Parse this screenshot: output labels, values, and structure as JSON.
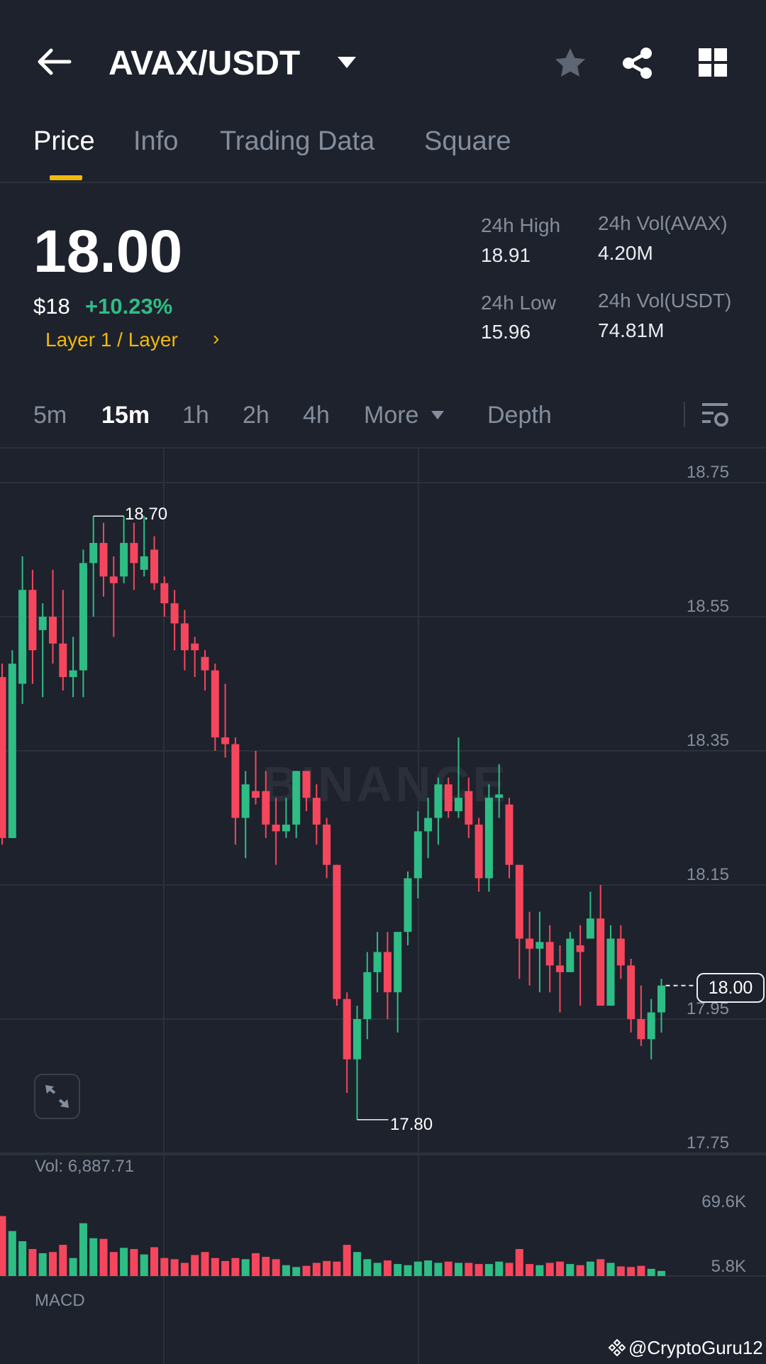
{
  "header": {
    "title": "AVAX/USDT",
    "back_icon": "arrow-left-icon",
    "dropdown_icon": "caret-down-icon",
    "favorite_icon": "star-icon",
    "share_icon": "share-icon",
    "grid_icon": "grid-icon"
  },
  "tabs": [
    {
      "label": "Price",
      "active": true
    },
    {
      "label": "Info"
    },
    {
      "label": "Trading Data"
    },
    {
      "label": "Square"
    }
  ],
  "ticker": {
    "last_price": "18.00",
    "usd_price": "$18",
    "change": "+10.23%",
    "category": "Layer 1 / Layer",
    "category_chevron": "›",
    "high_label": "24h High",
    "high": "18.91",
    "low_label": "24h Low",
    "low": "15.96",
    "vol_base_label": "24h Vol(AVAX)",
    "vol_base": "4.20M",
    "vol_quote_label": "24h Vol(USDT)",
    "vol_quote": "74.81M"
  },
  "intervals": [
    {
      "label": "5m"
    },
    {
      "label": "15m",
      "active": true
    },
    {
      "label": "1h"
    },
    {
      "label": "2h"
    },
    {
      "label": "4h"
    },
    {
      "label": "More"
    }
  ],
  "depth_label": "Depth",
  "chart_labels": {
    "watermark": "BINANCE",
    "high_marker": "18.70",
    "low_marker": "17.80",
    "last_price": "18.00",
    "volume": "Vol: 6,887.71",
    "macd": "MACD",
    "footer": "@CryptoGuru12"
  },
  "colors": {
    "up": "#2ebd85",
    "down": "#f6465d",
    "accent": "#f0b90b",
    "background": "#1e222d"
  },
  "chart_data": {
    "type": "candlestick",
    "interval": "15m",
    "price_ticks": [
      "18.75",
      "18.55",
      "18.35",
      "18.15",
      "17.95",
      "17.75"
    ],
    "price_tick_values": [
      18.75,
      18.55,
      18.35,
      18.15,
      17.95,
      17.75
    ],
    "volume_ticks": [
      "69.6K",
      "5.8K"
    ],
    "ohlc": [
      [
        18.46,
        18.48,
        18.21,
        18.22
      ],
      [
        18.22,
        18.5,
        18.22,
        18.48
      ],
      [
        18.45,
        18.64,
        18.42,
        18.59
      ],
      [
        18.59,
        18.62,
        18.45,
        18.5
      ],
      [
        18.53,
        18.57,
        18.43,
        18.55
      ],
      [
        18.55,
        18.62,
        18.48,
        18.51
      ],
      [
        18.51,
        18.59,
        18.44,
        18.46
      ],
      [
        18.46,
        18.52,
        18.43,
        18.47
      ],
      [
        18.47,
        18.65,
        18.43,
        18.63
      ],
      [
        18.63,
        18.7,
        18.55,
        18.66
      ],
      [
        18.66,
        18.69,
        18.58,
        18.61
      ],
      [
        18.61,
        18.64,
        18.52,
        18.6
      ],
      [
        18.61,
        18.7,
        18.6,
        18.66
      ],
      [
        18.66,
        18.69,
        18.59,
        18.63
      ],
      [
        18.62,
        18.7,
        18.61,
        18.64
      ],
      [
        18.65,
        18.67,
        18.59,
        18.6
      ],
      [
        18.6,
        18.61,
        18.55,
        18.57
      ],
      [
        18.57,
        18.59,
        18.5,
        18.54
      ],
      [
        18.54,
        18.56,
        18.47,
        18.5
      ],
      [
        18.51,
        18.52,
        18.46,
        18.5
      ],
      [
        18.49,
        18.5,
        18.44,
        18.47
      ],
      [
        18.47,
        18.48,
        18.35,
        18.37
      ],
      [
        18.37,
        18.45,
        18.34,
        18.36
      ],
      [
        18.36,
        18.37,
        18.21,
        18.25
      ],
      [
        18.25,
        18.32,
        18.19,
        18.3
      ],
      [
        18.29,
        18.35,
        18.27,
        18.28
      ],
      [
        18.29,
        18.32,
        18.22,
        18.24
      ],
      [
        18.24,
        18.28,
        18.18,
        18.23
      ],
      [
        18.23,
        18.28,
        18.22,
        18.24
      ],
      [
        18.24,
        18.32,
        18.22,
        18.32
      ],
      [
        18.32,
        18.32,
        18.26,
        18.28
      ],
      [
        18.28,
        18.3,
        18.21,
        18.24
      ],
      [
        18.24,
        18.25,
        18.16,
        18.18
      ],
      [
        18.18,
        18.18,
        17.97,
        17.98
      ],
      [
        17.98,
        17.99,
        17.84,
        17.89
      ],
      [
        17.89,
        17.97,
        17.8,
        17.95
      ],
      [
        17.95,
        18.05,
        17.92,
        18.02
      ],
      [
        18.02,
        18.08,
        17.99,
        18.05
      ],
      [
        18.05,
        18.08,
        17.95,
        17.99
      ],
      [
        17.99,
        18.08,
        17.93,
        18.08
      ],
      [
        18.08,
        18.17,
        18.06,
        18.16
      ],
      [
        18.16,
        18.26,
        18.13,
        18.23
      ],
      [
        18.23,
        18.28,
        18.19,
        18.25
      ],
      [
        18.25,
        18.31,
        18.21,
        18.3
      ],
      [
        18.3,
        18.31,
        18.25,
        18.26
      ],
      [
        18.26,
        18.37,
        18.25,
        18.28
      ],
      [
        18.29,
        18.31,
        18.22,
        18.24
      ],
      [
        18.24,
        18.25,
        18.14,
        18.16
      ],
      [
        18.16,
        18.3,
        18.14,
        18.28
      ],
      [
        18.28,
        18.33,
        18.25,
        18.285
      ],
      [
        18.27,
        18.28,
        18.16,
        18.18
      ],
      [
        18.18,
        18.18,
        18.01,
        18.07
      ],
      [
        18.07,
        18.11,
        18.0,
        18.055
      ],
      [
        18.055,
        18.11,
        17.99,
        18.065
      ],
      [
        18.065,
        18.09,
        17.99,
        18.03
      ],
      [
        18.03,
        18.06,
        17.96,
        18.02
      ],
      [
        18.02,
        18.08,
        18.02,
        18.07
      ],
      [
        18.06,
        18.09,
        17.97,
        18.05
      ],
      [
        18.07,
        18.14,
        18.07,
        18.1
      ],
      [
        18.1,
        18.15,
        17.97,
        17.97
      ],
      [
        17.97,
        18.09,
        17.97,
        18.07
      ],
      [
        18.07,
        18.09,
        18.01,
        18.03
      ],
      [
        18.03,
        18.04,
        17.93,
        17.95
      ],
      [
        17.95,
        18.0,
        17.91,
        17.92
      ],
      [
        17.92,
        17.98,
        17.89,
        17.96
      ],
      [
        17.96,
        18.01,
        17.93,
        18.0
      ]
    ],
    "volume_k": [
      82.0,
      61.5,
      47.6,
      36.9,
      31.2,
      32.8,
      42.6,
      24.6,
      72.2,
      51.7,
      50.8,
      32.8,
      38.5,
      36.9,
      29.5,
      39.4,
      24.6,
      23.0,
      18.0,
      28.7,
      32.8,
      24.6,
      20.5,
      24.6,
      23.0,
      31.2,
      26.2,
      23.0,
      14.8,
      12.3,
      13.9,
      18.0,
      20.5,
      19.7,
      42.6,
      32.8,
      23.0,
      18.0,
      21.3,
      16.4,
      14.8,
      19.7,
      21.3,
      18.0,
      19.7,
      18.0,
      18.0,
      16.4,
      16.4,
      19.7,
      18.0,
      36.9,
      16.4,
      14.8,
      18.0,
      19.7,
      16.4,
      14.8,
      19.7,
      23.0,
      18.0,
      13.1,
      12.3,
      13.9,
      9.8,
      6.9
    ]
  }
}
